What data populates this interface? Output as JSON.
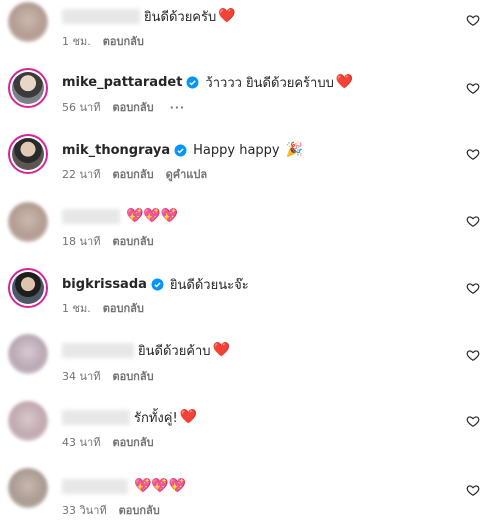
{
  "comments": [
    {
      "username": "",
      "text": "ยินดีด้วยครับ",
      "emoji": "❤️",
      "time": "1 ชม.",
      "reply": "ตอบกลับ"
    },
    {
      "username": "mike_pattaradet",
      "verified": true,
      "text": "ว้าววว ยินดีด้วยคร้าบบ",
      "emoji": "❤️",
      "time": "56 นาที",
      "reply": "ตอบกลับ",
      "more": "···"
    },
    {
      "username": "mik_thongraya",
      "verified": true,
      "text": "Happy happy",
      "emoji": "🎉",
      "time": "22 นาที",
      "reply": "ตอบกลับ",
      "translate": "ดูคำแปล"
    },
    {
      "username": "",
      "text": "",
      "emoji": "💖💖💖",
      "time": "18 นาที",
      "reply": "ตอบกลับ"
    },
    {
      "username": "bigkrissada",
      "verified": true,
      "text": "ยินดีด้วยนะจ๊ะ",
      "emoji": "",
      "time": "1 ชม.",
      "reply": "ตอบกลับ"
    },
    {
      "username": "",
      "text": "ยินดีด้วยค้าบ",
      "emoji": "❤️",
      "time": "34 นาที",
      "reply": "ตอบกลับ"
    },
    {
      "username": "",
      "text": "รักทั้งคู่!",
      "emoji": "❤️",
      "time": "43 นาที",
      "reply": "ตอบกลับ"
    },
    {
      "username": "",
      "text": "",
      "emoji": "💖💖💖",
      "time": "33 วินาที",
      "reply": "ตอบกลับ"
    }
  ],
  "icons": {
    "like": "heart-outline-icon",
    "verified": "verified-badge-icon"
  },
  "colors": {
    "verified": "#0095f6",
    "heart": "#e0245e",
    "ring": "#d6249f"
  }
}
